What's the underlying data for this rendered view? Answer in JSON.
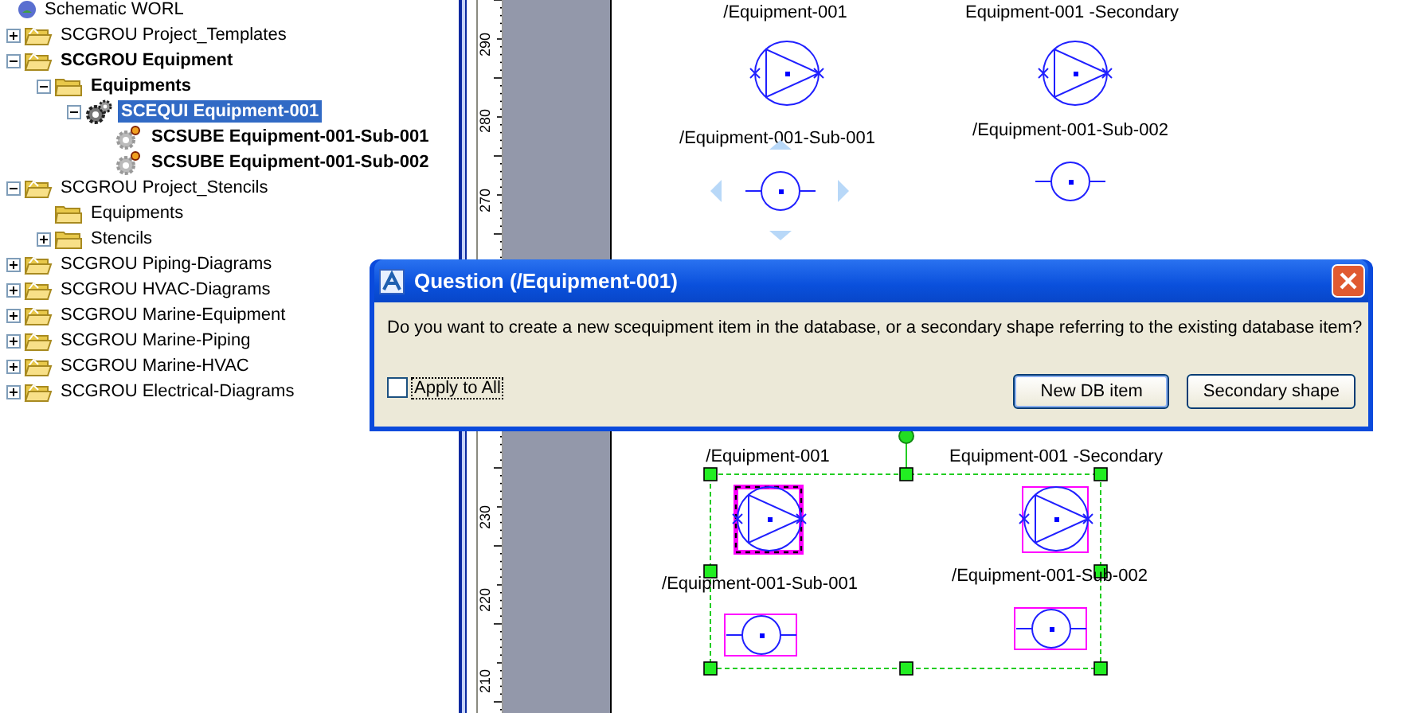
{
  "tree": {
    "items": [
      {
        "label": "Schematic WORL",
        "kind": "root",
        "selected": false,
        "bold": false,
        "children": [
          {
            "label": "SCGROU Project_Templates",
            "kind": "group",
            "expanded": false,
            "selected": false,
            "bold": false
          },
          {
            "label": "SCGROU Equipment",
            "kind": "group",
            "expanded": true,
            "selected": false,
            "bold": true,
            "children": [
              {
                "label": "Equipments",
                "kind": "folder",
                "expanded": true,
                "selected": false,
                "bold": true,
                "children": [
                  {
                    "label": "SCEQUI Equipment-001",
                    "kind": "equipment",
                    "expanded": true,
                    "selected": true,
                    "bold": true,
                    "children": [
                      {
                        "label": "SCSUBE Equipment-001-Sub-001",
                        "kind": "subequipment",
                        "selected": false,
                        "bold": true
                      },
                      {
                        "label": "SCSUBE Equipment-001-Sub-002",
                        "kind": "subequipment",
                        "selected": false,
                        "bold": true
                      }
                    ]
                  }
                ]
              }
            ]
          },
          {
            "label": "SCGROU Project_Stencils",
            "kind": "group",
            "expanded": true,
            "selected": false,
            "bold": false,
            "children": [
              {
                "label": "Equipments",
                "kind": "folder",
                "selected": false,
                "bold": false
              },
              {
                "label": "Stencils",
                "kind": "folder",
                "expanded": false,
                "selected": false,
                "bold": false
              }
            ]
          },
          {
            "label": "SCGROU Piping-Diagrams",
            "kind": "group",
            "expanded": false,
            "selected": false,
            "bold": false
          },
          {
            "label": "SCGROU HVAC-Diagrams",
            "kind": "group",
            "expanded": false,
            "selected": false,
            "bold": false
          },
          {
            "label": "SCGROU Marine-Equipment",
            "kind": "group",
            "expanded": false,
            "selected": false,
            "bold": false
          },
          {
            "label": "SCGROU Marine-Piping",
            "kind": "group",
            "expanded": false,
            "selected": false,
            "bold": false
          },
          {
            "label": "SCGROU Marine-HVAC",
            "kind": "group",
            "expanded": false,
            "selected": false,
            "bold": false
          },
          {
            "label": "SCGROU Electrical-Diagrams",
            "kind": "group",
            "expanded": false,
            "selected": false,
            "bold": false
          }
        ]
      }
    ]
  },
  "ruler": {
    "labels": [
      "290",
      "280",
      "270",
      "230",
      "220",
      "210"
    ]
  },
  "canvas": {
    "shapes": [
      {
        "label": "/Equipment-001",
        "kind": "pump",
        "selected": false,
        "focused": false
      },
      {
        "label": "Equipment-001 -Secondary",
        "kind": "pump",
        "selected": false,
        "focused": false
      },
      {
        "label": "/Equipment-001-Sub-001",
        "kind": "nozzle",
        "selected": false,
        "hovered": true
      },
      {
        "label": "/Equipment-001-Sub-002",
        "kind": "nozzle",
        "selected": false,
        "hovered": false
      },
      {
        "label": "/Equipment-001",
        "kind": "pump",
        "selected": true,
        "focused": true
      },
      {
        "label": "Equipment-001 -Secondary",
        "kind": "pump",
        "selected": true,
        "focused": false
      },
      {
        "label": "/Equipment-001-Sub-001",
        "kind": "nozzle",
        "selected": true,
        "hovered": false
      },
      {
        "label": "/Equipment-001-Sub-002",
        "kind": "nozzle",
        "selected": true,
        "hovered": false
      }
    ]
  },
  "dialog": {
    "title": "Question (/Equipment-001)",
    "message": "Do you want to create a new scequipment item in the database, or a secondary shape referring to the existing database item?",
    "apply_to_all": {
      "label": "Apply to All",
      "checked": false
    },
    "buttons": [
      "New DB item",
      "Secondary shape"
    ]
  }
}
